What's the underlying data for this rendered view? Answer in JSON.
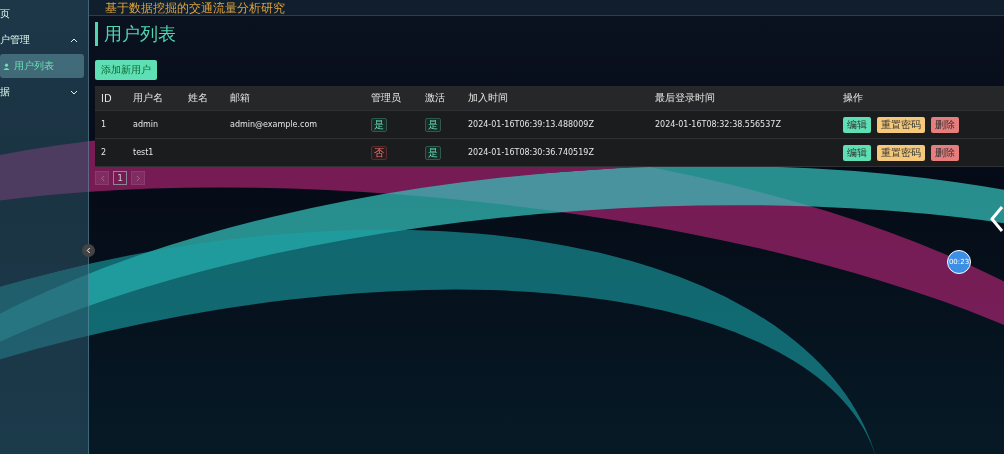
{
  "header": {
    "title": "基于数据挖掘的交通流量分析研究"
  },
  "sidebar": {
    "items": [
      {
        "label": "页",
        "kind": "link",
        "selected": false
      },
      {
        "label": "户管理",
        "kind": "group",
        "expanded": true,
        "selected": false,
        "children": [
          {
            "label": "用户列表",
            "selected": true
          }
        ]
      },
      {
        "label": "据",
        "kind": "group",
        "expanded": false,
        "selected": false
      }
    ]
  },
  "page": {
    "title": "用户列表",
    "add_button": "添加新用户"
  },
  "table": {
    "columns": [
      "ID",
      "用户名",
      "姓名",
      "邮箱",
      "管理员",
      "激活",
      "加入时间",
      "最后登录时间",
      "操作"
    ],
    "rows": [
      {
        "id": "1",
        "username": "admin",
        "email": "admin@example.com",
        "admin": {
          "text": "是",
          "yes": true
        },
        "active": {
          "text": "是",
          "yes": true
        },
        "joined": "2024-01-16T06:39:13.488009Z",
        "last_login": "2024-01-16T08:32:38.556537Z",
        "actions": [
          "编辑",
          "重置密码",
          "删除"
        ]
      },
      {
        "id": "2",
        "username": "test1",
        "admin": {
          "text": "否",
          "yes": false
        },
        "active": {
          "text": "是",
          "yes": true
        },
        "joined": "2024-01-16T08:30:36.740519Z",
        "actions": [
          "编辑",
          "重置密码",
          "删除"
        ]
      }
    ]
  },
  "pagination": {
    "pages": [
      {
        "label": "1",
        "selected": true
      }
    ]
  },
  "timer": {
    "text": "00:23"
  }
}
